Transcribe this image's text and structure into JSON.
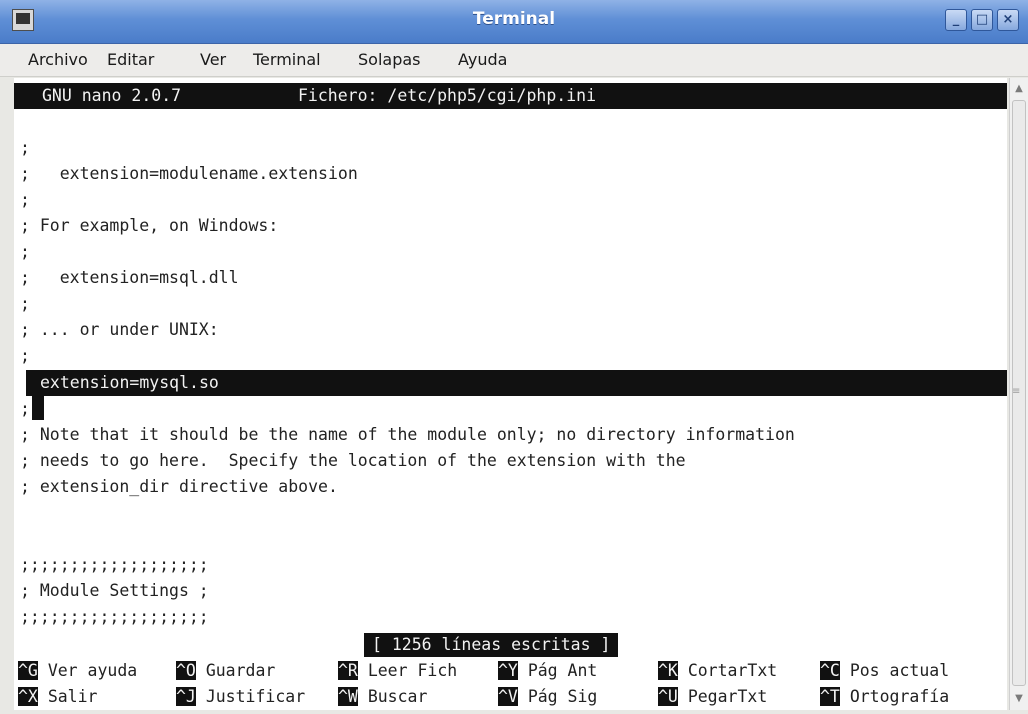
{
  "window": {
    "title": "Terminal"
  },
  "menu": [
    "Archivo",
    "Editar",
    "Ver",
    "Terminal",
    "Solapas",
    "Ayuda"
  ],
  "nano": {
    "version": "GNU nano 2.0.7",
    "file": "Fichero: /etc/php5/cgi/php.ini"
  },
  "lines": [
    "",
    ";",
    ";   extension=modulename.extension",
    ";",
    "; For example, on Windows:",
    ";",
    ";   extension=msql.dll",
    ";",
    "; ... or under UNIX:",
    ";",
    "extension=mysql.so",
    ";",
    "; Note that it should be the name of the module only; no directory information",
    "; needs to go here.  Specify the location of the extension with the",
    "; extension_dir directive above.",
    "",
    "",
    ";;;;;;;;;;;;;;;;;;;",
    "; Module Settings ;",
    ";;;;;;;;;;;;;;;;;;;"
  ],
  "status_message": "[ 1256 líneas escritas ]",
  "shortcuts_row1": [
    {
      "key": "^G",
      "label": "Ver ayuda"
    },
    {
      "key": "^O",
      "label": "Guardar"
    },
    {
      "key": "^R",
      "label": "Leer Fich"
    },
    {
      "key": "^Y",
      "label": "Pág Ant"
    },
    {
      "key": "^K",
      "label": "CortarTxt"
    },
    {
      "key": "^C",
      "label": "Pos actual"
    }
  ],
  "shortcuts_row2": [
    {
      "key": "^X",
      "label": "Salir"
    },
    {
      "key": "^J",
      "label": "Justificar"
    },
    {
      "key": "^W",
      "label": "Buscar"
    },
    {
      "key": "^V",
      "label": "Pág Sig"
    },
    {
      "key": "^U",
      "label": "PegarTxt"
    },
    {
      "key": "^T",
      "label": "Ortografía"
    }
  ]
}
